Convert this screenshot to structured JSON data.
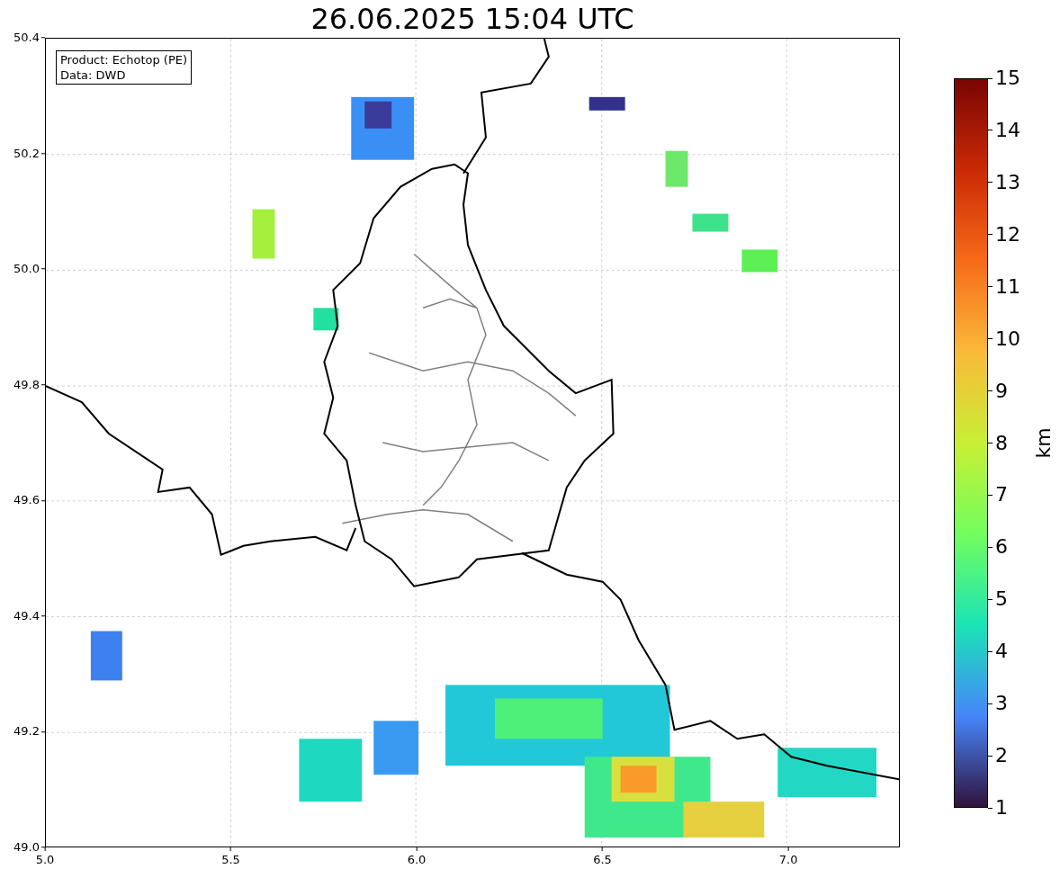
{
  "title": "26.06.2025 15:04 UTC",
  "legend": {
    "lines": [
      "Product: Echotop (PE)",
      "Data: DWD"
    ]
  },
  "axes": {
    "y_ticks": [
      "50.4",
      "50.2",
      "50.0",
      "49.8",
      "49.6",
      "49.4",
      "49.2",
      "49.0"
    ],
    "x_ticks": [
      "5.0",
      "5.5",
      "6.0",
      "6.5",
      "7.0"
    ]
  },
  "colorbar": {
    "label": "km",
    "ticks": [
      "15",
      "14",
      "13",
      "12",
      "11",
      "10",
      "9",
      "8",
      "7",
      "6",
      "5",
      "4",
      "3",
      "2",
      "1"
    ]
  }
}
